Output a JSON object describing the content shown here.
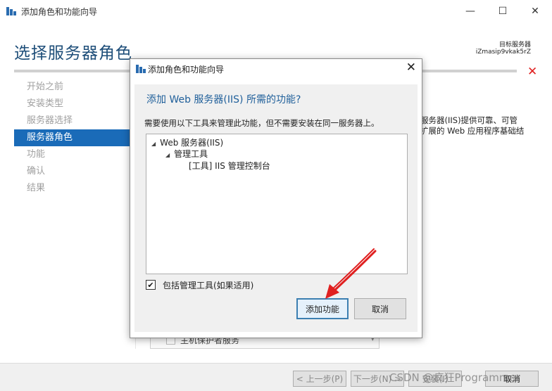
{
  "window": {
    "title": "添加角色和功能向导",
    "min_glyph": "—",
    "max_glyph": "☐",
    "close_glyph": "✕"
  },
  "page": {
    "title": "选择服务器角色",
    "target_label": "目标服务器",
    "target_value": "iZmasip9vkak5rZ",
    "error_glyph": "✕"
  },
  "nav": {
    "items": [
      "开始之前",
      "安装类型",
      "服务器选择",
      "服务器角色",
      "功能",
      "确认",
      "结果"
    ],
    "active_index": 3
  },
  "background": {
    "description_lines": [
      "服务器(IIS)提供可靠、可管",
      "扩展的 Web 应用程序基础结"
    ],
    "combo_text": "主机保护者服务",
    "combo_arrow": "▾"
  },
  "dialog": {
    "title": "添加角色和功能向导",
    "close_glyph": "✕",
    "heading": "添加 Web 服务器(IIS) 所需的功能?",
    "description": "需要使用以下工具来管理此功能，但不需要安装在同一服务器上。",
    "tree": [
      {
        "expander": "◢",
        "label": "Web 服务器(IIS)"
      },
      {
        "expander": "◢",
        "label": "管理工具"
      },
      {
        "expander": "",
        "label": "[工具] IIS 管理控制台"
      }
    ],
    "include_tools_checked": true,
    "check_glyph": "✔",
    "include_tools_label": "包括管理工具(如果适用)",
    "add_button": "添加功能",
    "cancel_button": "取消"
  },
  "bottom": {
    "prev": "< 上一步(P)",
    "next": "下一步(N) >",
    "install": "安装(I)",
    "cancel": "取消"
  },
  "watermark": "CSDN @疯狂Programmer",
  "colors": {
    "accent": "#1a6bb8",
    "heading": "#1f5f9a",
    "annotation_arrow": "#e02020"
  }
}
